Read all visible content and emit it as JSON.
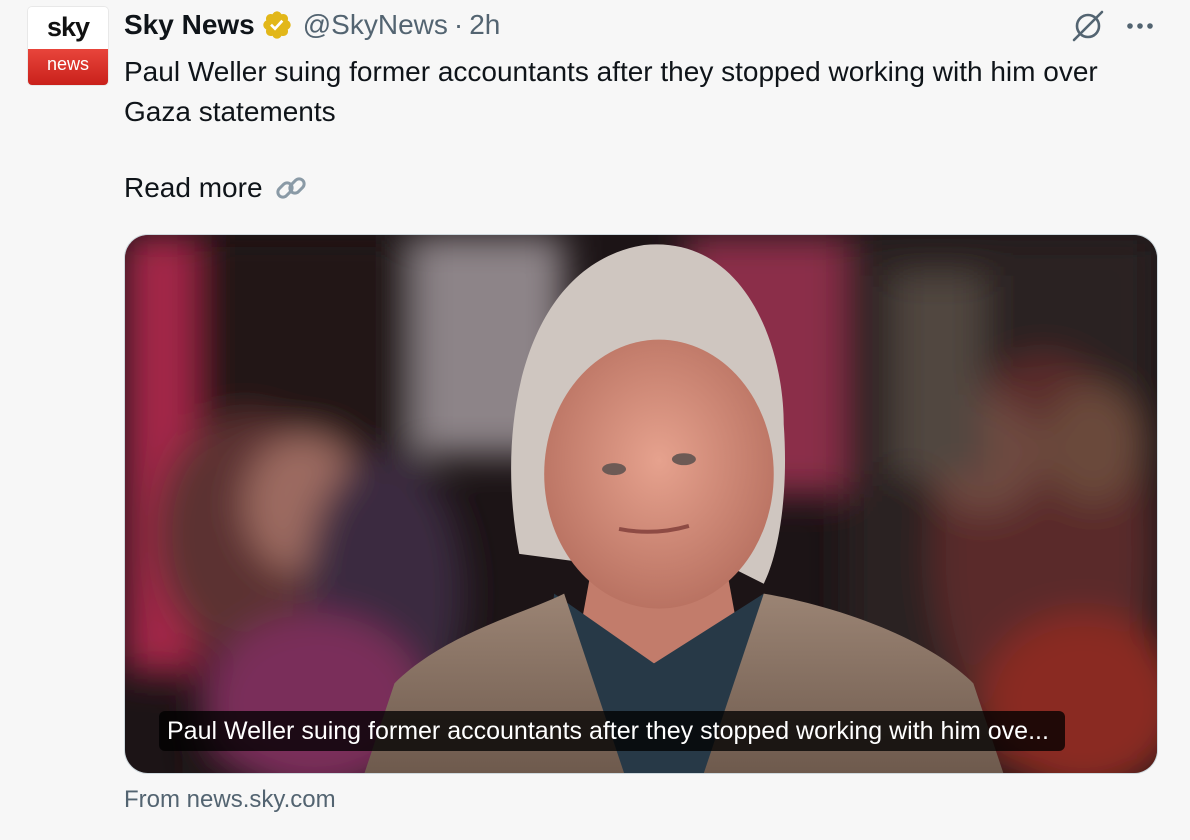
{
  "avatar": {
    "top_text": "sky",
    "bottom_text": "news"
  },
  "header": {
    "name": "Sky News",
    "handle": "@SkyNews",
    "separator": "·",
    "time": "2h"
  },
  "tweet": {
    "text": "Paul Weller suing former accountants after they stopped working with him over Gaza statements",
    "read_more_label": "Read more"
  },
  "card": {
    "caption": "Paul Weller suing former accountants after they stopped working with him ove...",
    "source": "From news.sky.com"
  },
  "icons": {
    "verified": "verified-badge-gold-icon",
    "grok": "grok-icon",
    "more": "more-options-icon",
    "link": "link-icon"
  },
  "colors": {
    "verified_gold": "#e2b719",
    "secondary_text": "#536471",
    "primary_text": "#0f1419",
    "brand_red": "#d8312b"
  }
}
